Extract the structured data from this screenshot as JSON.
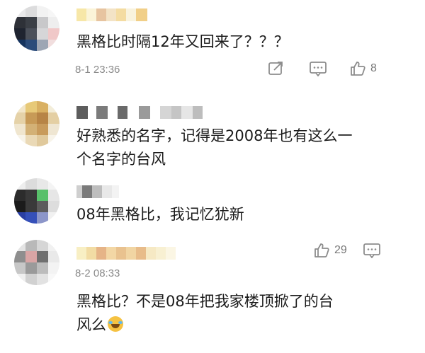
{
  "comments": [
    {
      "text_lines": [
        "黑格比时隔12年又回来了？？？"
      ],
      "time": "8-1 23:36",
      "likes": "8",
      "icons": [
        "external-link-icon",
        "comment-reply-icon",
        "thumbs-up-icon"
      ]
    },
    {
      "text_lines": [
        "好熟悉的名字，记得是2008年也有这么一",
        "个名字的台风"
      ]
    },
    {
      "text_lines": [
        "08年黑格比，我记忆犹新"
      ]
    },
    {
      "text_lines": [
        "黑格比？不是08年把我家楼顶掀了的台",
        "风么"
      ],
      "time": "8-2 08:33",
      "likes": "29",
      "icons": [
        "thumbs-up-icon",
        "comment-reply-icon",
        "laugh-cry-emoji-icon"
      ]
    }
  ],
  "colors": {
    "text": "#1b1b1b",
    "meta": "#8a8a8a",
    "icon": "#8c8c8c"
  }
}
